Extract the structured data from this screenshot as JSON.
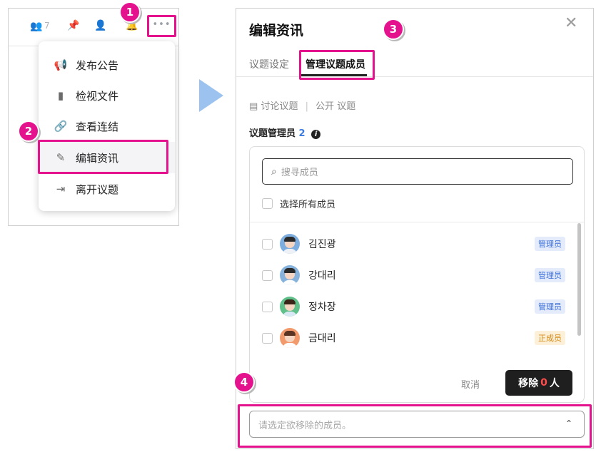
{
  "left": {
    "toolbar": {
      "member_count": "7",
      "members_icon": "users-icon",
      "pin_icon": "pin-icon",
      "add_member_icon": "add-user-icon",
      "notification_icon": "bell-icon",
      "more_label": "•••"
    },
    "menu": [
      {
        "icon": "megaphone-icon",
        "label": "发布公告",
        "glyph": "📢"
      },
      {
        "icon": "file-icon",
        "label": "检视文件",
        "glyph": "▮"
      },
      {
        "icon": "link-icon",
        "label": "查看连结",
        "glyph": "🔗"
      },
      {
        "icon": "pencil-icon",
        "label": "编辑资讯",
        "glyph": "✎"
      },
      {
        "icon": "exit-icon",
        "label": "离开议题",
        "glyph": "⇥"
      }
    ]
  },
  "badges": [
    "1",
    "2",
    "3",
    "4"
  ],
  "dialog": {
    "title": "编辑资讯",
    "close": "✕",
    "tabs": [
      "议题设定",
      "管理议题成员"
    ],
    "sub_info": {
      "icon": "chat-icon",
      "type": "讨论议题",
      "visibility": "公开 议题"
    },
    "admin_label": "议题管理员",
    "admin_count": "2",
    "info_icon": "i",
    "search_placeholder": "搜寻成员",
    "select_all": "选择所有成员",
    "members": [
      {
        "name": "김진광",
        "role": "管理员",
        "role_type": "admin",
        "bg": "#7eaee0",
        "hair": "#2a2a2a",
        "shirt": "#eef2f7"
      },
      {
        "name": "강대리",
        "role": "管理员",
        "role_type": "admin",
        "bg": "#86b2dc",
        "hair": "#2a2a2a",
        "shirt": "#ffffff"
      },
      {
        "name": "정차장",
        "role": "管理员",
        "role_type": "admin",
        "bg": "#5fc08a",
        "hair": "#3a2418",
        "shirt": "#d9e8f5"
      },
      {
        "name": "금대리",
        "role": "正成员",
        "role_type": "member",
        "bg": "#f29a6c",
        "hair": "#5a3322",
        "shirt": "#ffffff"
      }
    ],
    "cancel": "取消",
    "remove_prefix": "移除",
    "remove_count": "0",
    "remove_suffix": "人",
    "remove_placeholder": "请选定欲移除的成员。",
    "chevron": "⌃"
  }
}
